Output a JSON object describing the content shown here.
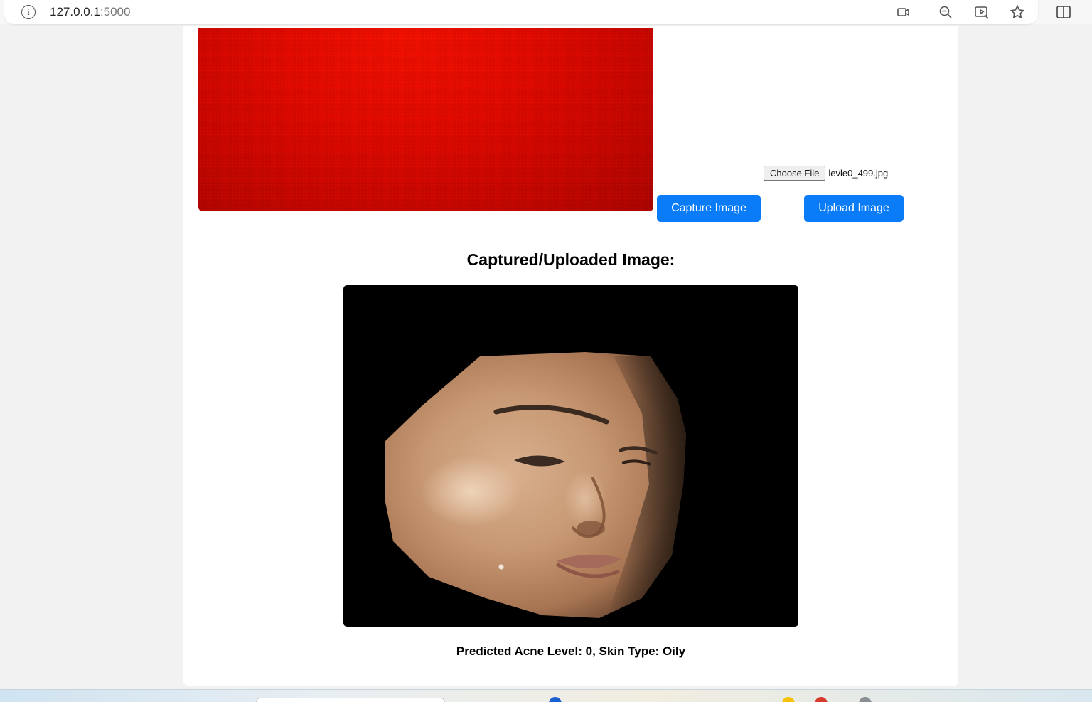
{
  "browser": {
    "url_host": "127.0.0.1",
    "url_port": ":5000",
    "icons": [
      "info-icon",
      "video-camera-icon",
      "zoom-out-icon",
      "cast-icon",
      "star-icon",
      "split-screen-icon"
    ]
  },
  "capture": {
    "file_button_label": "Choose File",
    "file_name": "levle0_499.jpg",
    "capture_button_label": "Capture Image",
    "upload_button_label": "Upload Image"
  },
  "result": {
    "heading": "Captured/Uploaded Image:",
    "prediction_text": "Predicted Acne Level: 0, Skin Type: Oily"
  },
  "colors": {
    "button_blue": "#0a7cf7",
    "camera_red": "#e20a00",
    "page_background": "#f2f2f2"
  }
}
